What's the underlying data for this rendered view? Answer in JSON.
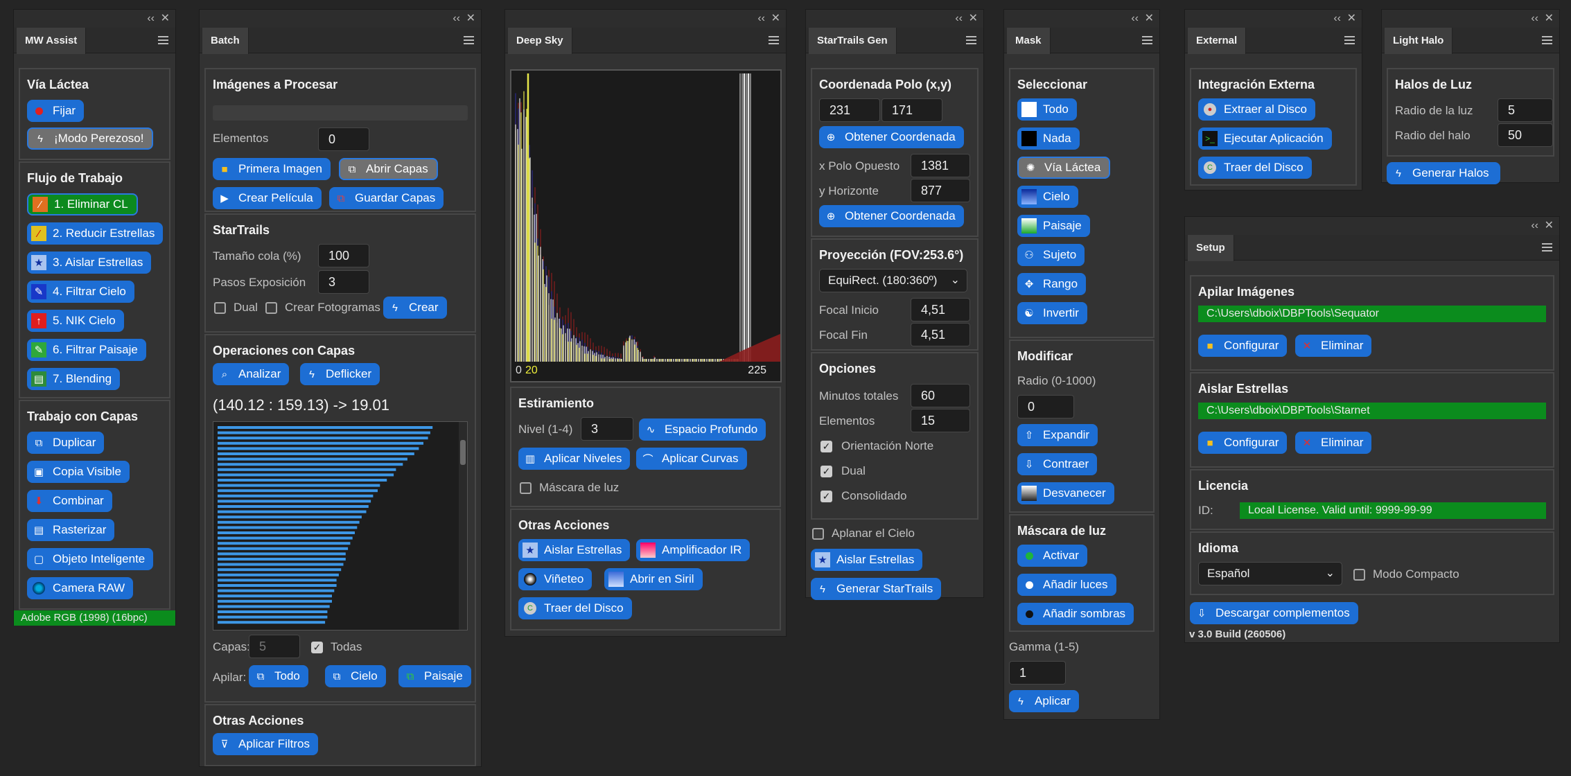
{
  "mw": {
    "tab": "MW Assist",
    "via_lactea": "Vía Láctea",
    "fijar": "Fijar",
    "modo_perezoso": "¡Modo Perezoso!",
    "flujo": "Flujo de Trabajo",
    "steps": [
      "1. Eliminar CL",
      "2. Reducir Estrellas",
      "3. Aislar Estrellas",
      "4. Filtrar Cielo",
      "5. NIK Cielo",
      "6. Filtrar Paisaje",
      "7. Blending"
    ],
    "capas_title": "Trabajo con Capas",
    "capas": [
      "Duplicar",
      "Copia Visible",
      "Combinar",
      "Rasterizar",
      "Objeto Inteligente",
      "Camera RAW"
    ],
    "profile": "Adobe RGB (1998) (16bpc)"
  },
  "batch": {
    "tab": "Batch",
    "imgs_title": "Imágenes a Procesar",
    "elementos_label": "Elementos",
    "elementos_value": "0",
    "primera_imagen": "Primera Imagen",
    "abrir_capas": "Abrir Capas",
    "crear_pelicula": "Crear Película",
    "guardar_capas": "Guardar Capas",
    "startrails_title": "StarTrails",
    "tamano_label": "Tamaño cola (%)",
    "tamano_value": "100",
    "pasos_label": "Pasos Exposición",
    "pasos_value": "3",
    "dual": "Dual",
    "crear_fotogramas": "Crear Fotogramas",
    "crear": "Crear",
    "ops_title": "Operaciones con Capas",
    "analizar": "Analizar",
    "deflicker": "Deflicker",
    "stats": "(140.12 : 159.13) -> 19.01",
    "deflicker_bars": [
      0.94,
      0.93,
      0.92,
      0.9,
      0.88,
      0.86,
      0.83,
      0.81,
      0.78,
      0.77,
      0.74,
      0.71,
      0.7,
      0.68,
      0.67,
      0.66,
      0.65,
      0.63,
      0.62,
      0.61,
      0.6,
      0.59,
      0.58,
      0.57,
      0.56,
      0.56,
      0.55,
      0.54,
      0.53,
      0.52,
      0.52,
      0.51,
      0.5,
      0.5,
      0.49,
      0.48,
      0.48,
      0.47
    ],
    "capas_label": "Capas:",
    "capas_value": "5",
    "todas": "Todas",
    "apilar_label": "Apilar:",
    "todo": "Todo",
    "cielo": "Cielo",
    "paisaje": "Paisaje",
    "otras_title": "Otras Acciones",
    "aplicar_filtros": "Aplicar Filtros"
  },
  "deep": {
    "tab": "Deep Sky",
    "hist_left0": "0",
    "hist_left": "20",
    "hist_right": "225",
    "estir_title": "Estiramiento",
    "nivel_label": "Nivel (1-4)",
    "nivel_value": "3",
    "espacio": "Espacio Profundo",
    "niveles": "Aplicar Niveles",
    "curvas": "Aplicar Curvas",
    "mascara": "Máscara de luz",
    "otras_title": "Otras Acciones",
    "aislar": "Aislar Estrellas",
    "amplificador": "Amplificador IR",
    "vineteo": "Viñeteo",
    "siril": "Abrir en Siril",
    "traer": "Traer del Disco",
    "colors": {
      "white": "#e8e8e8",
      "yellow": "#e8e84a",
      "blue": "#2a2a8c",
      "red": "#8c1e1e"
    }
  },
  "star": {
    "tab": "StarTrails Gen",
    "coord_title": "Coordenada Polo (x,y)",
    "x": "231",
    "y": "171",
    "obtener": "Obtener Coordenada",
    "xopuesto_label": "x Polo Opuesto",
    "xopuesto_value": "1381",
    "yhor_label": "y Horizonte",
    "yhor_value": "877",
    "proy_title": "Proyección (FOV:253.6°)",
    "proy_select": "EquiRect. (180:360º)",
    "focal_ini_label": "Focal Inicio",
    "focal_ini_value": "4,51",
    "focal_fin_label": "Focal Fin",
    "focal_fin_value": "4,51",
    "opciones_title": "Opciones",
    "min_label": "Minutos totales",
    "min_value": "60",
    "elem_label": "Elementos",
    "elem_value": "15",
    "orient": "Orientación Norte",
    "dual": "Dual",
    "consol": "Consolidado",
    "aplanar": "Aplanar el Cielo",
    "aislar": "Aislar Estrellas",
    "generar": "Generar StarTrails"
  },
  "mask": {
    "tab": "Mask",
    "sel_title": "Seleccionar",
    "todo": "Todo",
    "nada": "Nada",
    "via": "Vía Láctea",
    "cielo": "Cielo",
    "paisaje": "Paisaje",
    "sujeto": "Sujeto",
    "rango": "Rango",
    "invertir": "Invertir",
    "mod_title": "Modificar",
    "radio_label": "Radio (0-1000)",
    "radio_value": "0",
    "expandir": "Expandir",
    "contraer": "Contraer",
    "desvanecer": "Desvanecer",
    "luz_title": "Máscara de luz",
    "activar": "Activar",
    "anadir_luces": "Añadir luces",
    "anadir_sombras": "Añadir sombras",
    "gamma_label": "Gamma (1-5)",
    "gamma_value": "1",
    "aplicar": "Aplicar"
  },
  "ext": {
    "tab": "External",
    "title": "Integración Externa",
    "extraer": "Extraer al Disco",
    "ejecutar": "Ejecutar Aplicación",
    "traer": "Traer del Disco"
  },
  "halo": {
    "tab": "Light Halo",
    "title": "Halos de Luz",
    "radio_luz_label": "Radio de la luz",
    "radio_luz_value": "5",
    "radio_halo_label": "Radio del halo",
    "radio_halo_value": "50",
    "generar": "Generar Halos"
  },
  "setup": {
    "tab": "Setup",
    "apilar_title": "Apilar Imágenes",
    "apilar_path": "C:\\Users\\dboix\\DBPTools\\Sequator",
    "configurar": "Configurar",
    "eliminar": "Eliminar",
    "aislar_title": "Aislar Estrellas",
    "aislar_path": "C:\\Users\\dboix\\DBPTools\\Starnet",
    "lic_title": "Licencia",
    "id_label": "ID:",
    "lic_value": "Local License. Valid until: 9999-99-99",
    "idioma_title": "Idioma",
    "idioma_value": "Español",
    "modo_compacto": "Modo Compacto",
    "descargar": "Descargar complementos",
    "version": "v 3.0 Build (260506)"
  }
}
